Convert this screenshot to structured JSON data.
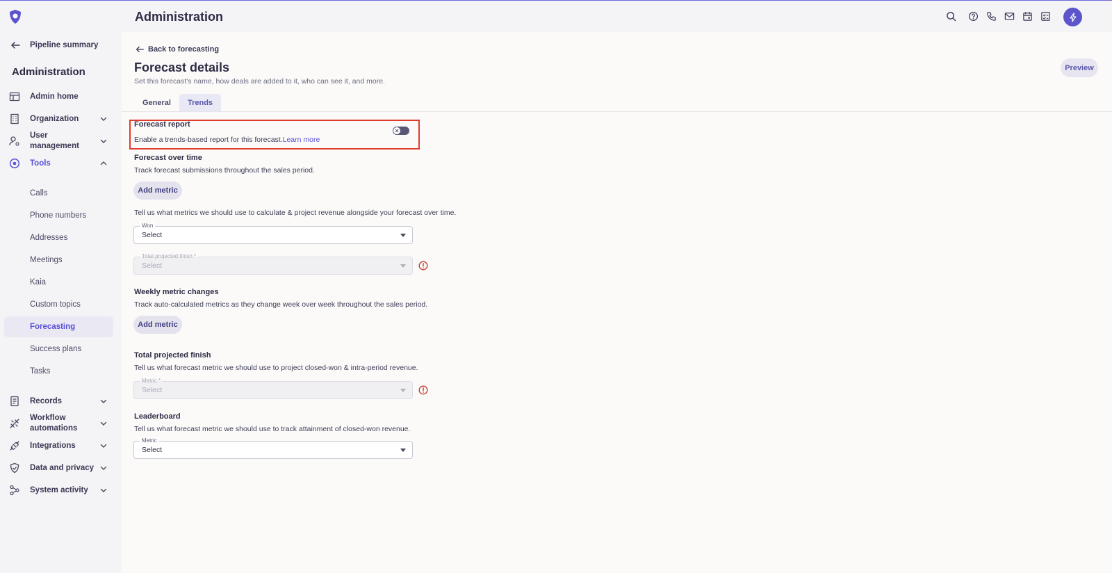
{
  "sidebar": {
    "back_label": "Pipeline summary",
    "title": "Administration",
    "items": [
      {
        "label": "Admin home",
        "icon": "table-icon"
      },
      {
        "label": "Organization",
        "icon": "building-icon"
      },
      {
        "label": "User management",
        "icon": "user-gear-icon"
      },
      {
        "label": "Tools",
        "icon": "tools-icon"
      },
      {
        "label": "Records",
        "icon": "records-icon"
      },
      {
        "label": "Workflow automations",
        "icon": "automation-icon"
      },
      {
        "label": "Integrations",
        "icon": "plug-icon"
      },
      {
        "label": "Data and privacy",
        "icon": "shield-icon"
      },
      {
        "label": "System activity",
        "icon": "network-icon"
      }
    ],
    "tools_subitems": [
      "Calls",
      "Phone numbers",
      "Addresses",
      "Meetings",
      "Kaia",
      "Custom topics",
      "Forecasting",
      "Success plans",
      "Tasks"
    ],
    "selected_subitem": "Forecasting"
  },
  "header": {
    "title": "Administration",
    "icons": [
      "search-icon",
      "help-icon",
      "phone-icon",
      "mail-icon",
      "calendar-icon",
      "checklist-icon",
      "lightning-icon"
    ]
  },
  "main": {
    "back_link": "Back to forecasting",
    "title": "Forecast details",
    "subtitle": "Set this forecast's name, how deals are added to it, who can see it, and more.",
    "preview_label": "Preview",
    "tabs": [
      {
        "label": "General"
      },
      {
        "label": "Trends"
      }
    ],
    "active_tab": "Trends",
    "forecast_report": {
      "title": "Forecast report",
      "text": "Enable a trends-based report for this forecast.",
      "link": "Learn more",
      "toggle_on": false
    },
    "forecast_over_time": {
      "title": "Forecast over time",
      "text": "Track forecast submissions throughout the sales period.",
      "button": "Add metric",
      "note": "Tell us what metrics we should use to calculate & project revenue alongside your forecast over time.",
      "won": {
        "label": "Won",
        "value": "Select"
      },
      "total": {
        "label": "Total projected finish *",
        "value": "Select"
      }
    },
    "weekly": {
      "title": "Weekly metric changes",
      "text": "Track auto-calculated metrics as they change week over week throughout the sales period.",
      "button": "Add metric"
    },
    "total_projected": {
      "title": "Total projected finish",
      "text": "Tell us what forecast metric we should use to project closed-won & intra-period revenue.",
      "metric": {
        "label": "Metric *",
        "value": "Select"
      }
    },
    "leaderboard": {
      "title": "Leaderboard",
      "text": "Tell us what forecast metric we should use to track attainment of closed-won revenue.",
      "metric": {
        "label": "Metric",
        "value": "Select"
      }
    }
  },
  "colors": {
    "accent": "#5850d6",
    "highlight": "#e23a2c",
    "error": "#c0392b"
  }
}
